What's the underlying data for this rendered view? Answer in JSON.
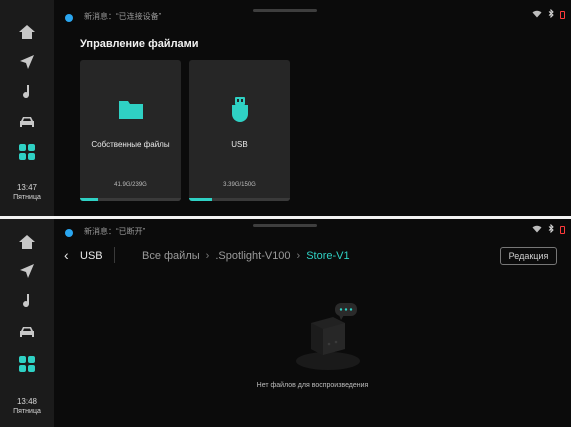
{
  "top_panel": {
    "notification_text": "新消息：“已连接设备”",
    "title": "Управление файлами",
    "time": "13:47",
    "weekday": "Пятница",
    "cards": [
      {
        "label": "Собственные файлы",
        "size": "41.9G/239G",
        "icon": "folder-icon",
        "progress": 0.18
      },
      {
        "label": "USB",
        "size": "3.39G/150G",
        "icon": "usb-drive-icon",
        "progress": 0.23
      }
    ]
  },
  "bottom_panel": {
    "notification_text": "新消息：“已断开”",
    "time": "13:48",
    "weekday": "Пятница",
    "usb_label": "USB",
    "breadcrumb": [
      "Все файлы",
      ".Spotlight-V100",
      "Store-V1"
    ],
    "edit_button": "Редакция",
    "empty_message": "Нет файлов для воспроизведения"
  },
  "sidebar_icons": [
    "home-icon",
    "navigation-icon",
    "music-icon",
    "car-icon",
    "apps-icon"
  ],
  "status_icons": [
    "wifi-icon",
    "bluetooth-icon",
    "battery-icon"
  ],
  "colors": {
    "accent": "#2fd1c4",
    "notification_dot": "#2aa6f0",
    "battery": "#ff3a3a",
    "background": "#0b0b0b",
    "card": "#262626",
    "sidebar": "#1b1b1b"
  }
}
